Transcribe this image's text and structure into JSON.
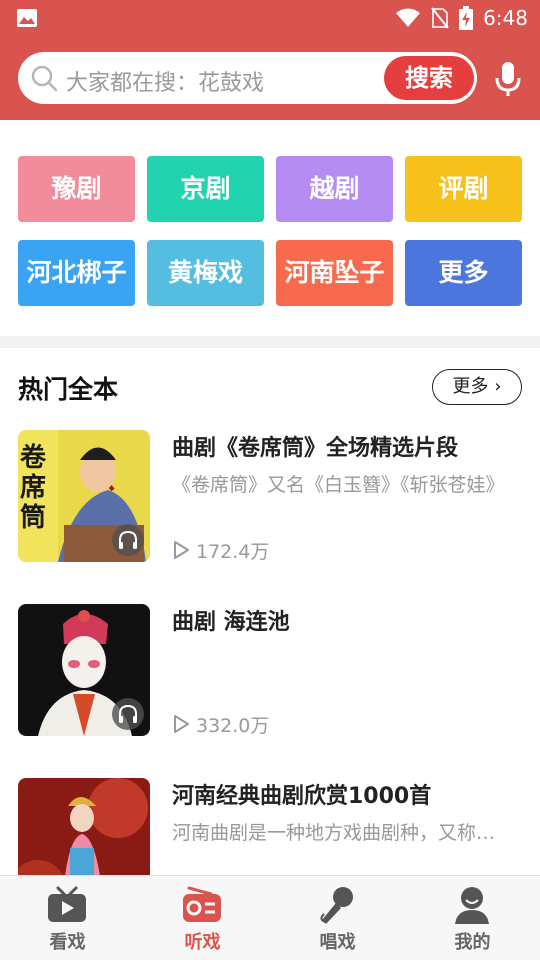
{
  "status_bar": {
    "time": "6:48"
  },
  "search": {
    "placeholder": "大家都在搜：花鼓戏",
    "button_label": "搜索"
  },
  "categories": [
    {
      "label": "豫剧",
      "color": "#f28b9a"
    },
    {
      "label": "京剧",
      "color": "#22d3b0"
    },
    {
      "label": "越剧",
      "color": "#b48cf2"
    },
    {
      "label": "评剧",
      "color": "#f5c11a"
    },
    {
      "label": "河北梆子",
      "color": "#3aa3f4"
    },
    {
      "label": "黄梅戏",
      "color": "#55bde0"
    },
    {
      "label": "河南坠子",
      "color": "#f76a4e"
    },
    {
      "label": "更多",
      "color": "#4a76de"
    }
  ],
  "section": {
    "title": "热门全本",
    "more_label": "更多"
  },
  "items": [
    {
      "title": "曲剧《卷席筒》全场精选片段",
      "desc": "《卷席筒》又名《白玉簪》《斩张苍娃》",
      "plays": "172.4万",
      "thumb_text": "卷席筒"
    },
    {
      "title": "曲剧 海连池",
      "desc": "",
      "plays": "332.0万"
    },
    {
      "title": "河南经典曲剧欣赏1000首",
      "desc": "河南曲剧是一种地方戏曲剧种，又称曲子戏",
      "plays": ""
    }
  ],
  "bottom_nav": [
    {
      "label": "看戏",
      "icon": "tv-icon",
      "active": false
    },
    {
      "label": "听戏",
      "icon": "radio-icon",
      "active": true
    },
    {
      "label": "唱戏",
      "icon": "microphone-icon",
      "active": false
    },
    {
      "label": "我的",
      "icon": "user-icon",
      "active": false
    }
  ],
  "colors": {
    "header": "#d9534f",
    "search_button": "#e53e3e",
    "active_nav": "#d9534f"
  }
}
